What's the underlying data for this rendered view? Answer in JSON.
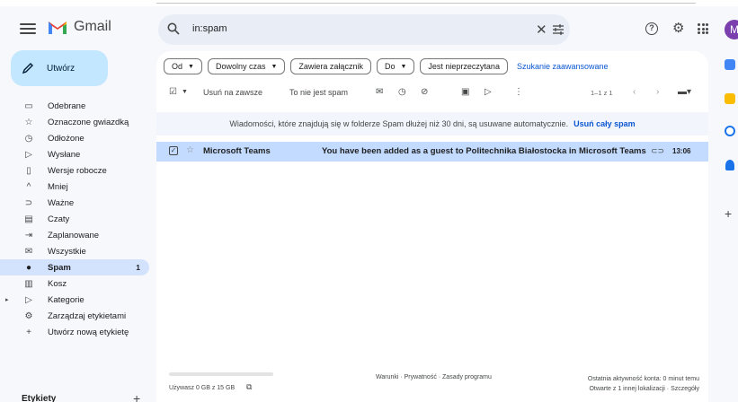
{
  "app": {
    "name": "Gmail",
    "avatar_letter": "M"
  },
  "search": {
    "query": "in:spam"
  },
  "compose": {
    "label": "Utwórz"
  },
  "sidebar": {
    "items": [
      {
        "label": "Odebrane",
        "icon": "inbox-icon"
      },
      {
        "label": "Oznaczone gwiazdką",
        "icon": "star-icon"
      },
      {
        "label": "Odłożone",
        "icon": "clock-icon"
      },
      {
        "label": "Wysłane",
        "icon": "send-icon"
      },
      {
        "label": "Wersje robocze",
        "icon": "draft-icon"
      },
      {
        "label": "Mniej",
        "icon": "chevron-up-icon"
      },
      {
        "label": "Ważne",
        "icon": "important-icon"
      },
      {
        "label": "Czaty",
        "icon": "chat-icon"
      },
      {
        "label": "Zaplanowane",
        "icon": "scheduled-icon"
      },
      {
        "label": "Wszystkie",
        "icon": "all-mail-icon"
      },
      {
        "label": "Spam",
        "icon": "spam-icon",
        "count": "1"
      },
      {
        "label": "Kosz",
        "icon": "trash-icon"
      },
      {
        "label": "Kategorie",
        "icon": "label-icon"
      },
      {
        "label": "Zarządzaj etykietami",
        "icon": "gear-icon"
      },
      {
        "label": "Utwórz nową etykietę",
        "icon": "plus-icon"
      }
    ],
    "labels_header": "Etykiety"
  },
  "filters": {
    "from": "Od",
    "time": "Dowolny czas",
    "attachment": "Zawiera załącznik",
    "to": "Do",
    "unread": "Jest nieprzeczytana",
    "advanced": "Szukanie zaawansowane"
  },
  "toolbar": {
    "delete_forever": "Usuń na zawsze",
    "not_spam": "To nie jest spam",
    "pager": "1–1 z 1"
  },
  "banner": {
    "text": "Wiadomości, które znajdują się w folderze Spam dłużej niż 30 dni, są usuwane automatycznie.",
    "action": "Usuń cały spam"
  },
  "emails": [
    {
      "sender": "Microsoft Teams",
      "subject": "You have been added as a guest to Politechnika Białostocka in Microsoft Teams",
      "time": "13:06"
    }
  ],
  "footer": {
    "storage": "Używasz 0 GB z 15 GB",
    "terms": "Warunki · Prywatność · Zasady programu",
    "activity": "Ostatnia aktywność konta: 0 minut temu",
    "details": "Otwarte z 1 innej lokalizacji · Szczegóły"
  },
  "colors": {
    "accent": "#0b57d0",
    "compose_bg": "#c2e7ff",
    "selected_row": "#c2dbff",
    "active_nav": "#d3e3fd",
    "avatar": "#7b3fae"
  }
}
